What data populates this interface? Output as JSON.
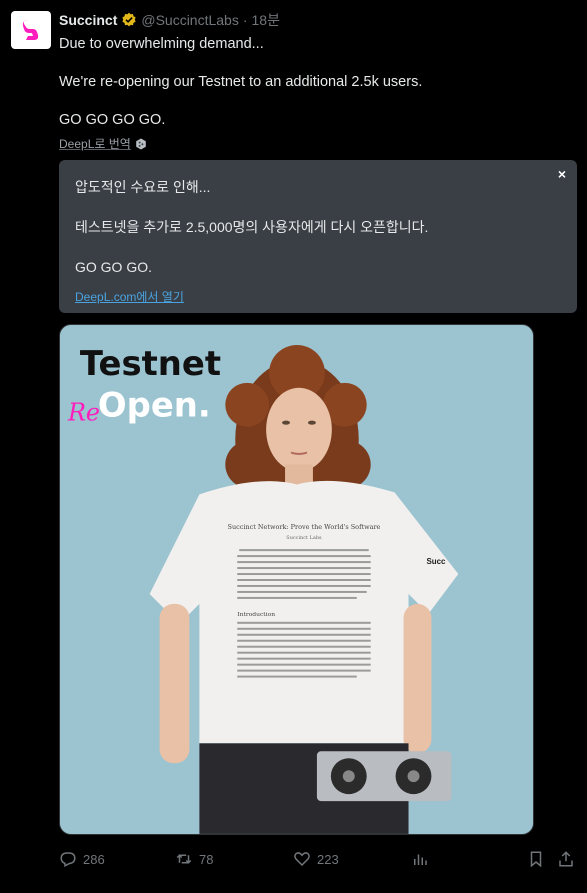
{
  "post": {
    "author_name": "Succinct",
    "handle": "@SuccinctLabs",
    "separator": "·",
    "time": "18분",
    "lines": [
      "Due to overwhelming demand...",
      "",
      "We're re-opening our Testnet to an additional 2.5k users.",
      "",
      "GO GO GO GO."
    ],
    "translate_label": "DeepL로 번역"
  },
  "translation": {
    "close_label": "×",
    "lines": [
      "압도적인 수요로 인해...",
      "테스트넷을 추가로 2.5,000명의 사용자에게 다시 오픈합니다.",
      "GO GO GO."
    ],
    "open_link": "DeepL.com에서 열기"
  },
  "media": {
    "headline_1": "Testnet",
    "headline_re": "Re",
    "headline_2": "Open.",
    "shirt_title": "Succinct Network: Prove the World's Software",
    "shirt_subtitle": "Succinct Labs",
    "shirt_section": "Introduction",
    "sleeve_text": "Succ"
  },
  "actions": {
    "replies": "286",
    "reposts": "78",
    "likes": "223"
  },
  "colors": {
    "background": "#000000",
    "verified": "#e2b719",
    "brand_pink": "#ff1dbd",
    "link_blue": "#4aa3e0",
    "media_bg": "#9bc3d0"
  },
  "icons": [
    "verified-icon",
    "deepl-icon",
    "close-icon",
    "reply-icon",
    "repost-icon",
    "like-icon",
    "views-icon",
    "bookmark-icon",
    "share-icon"
  ]
}
